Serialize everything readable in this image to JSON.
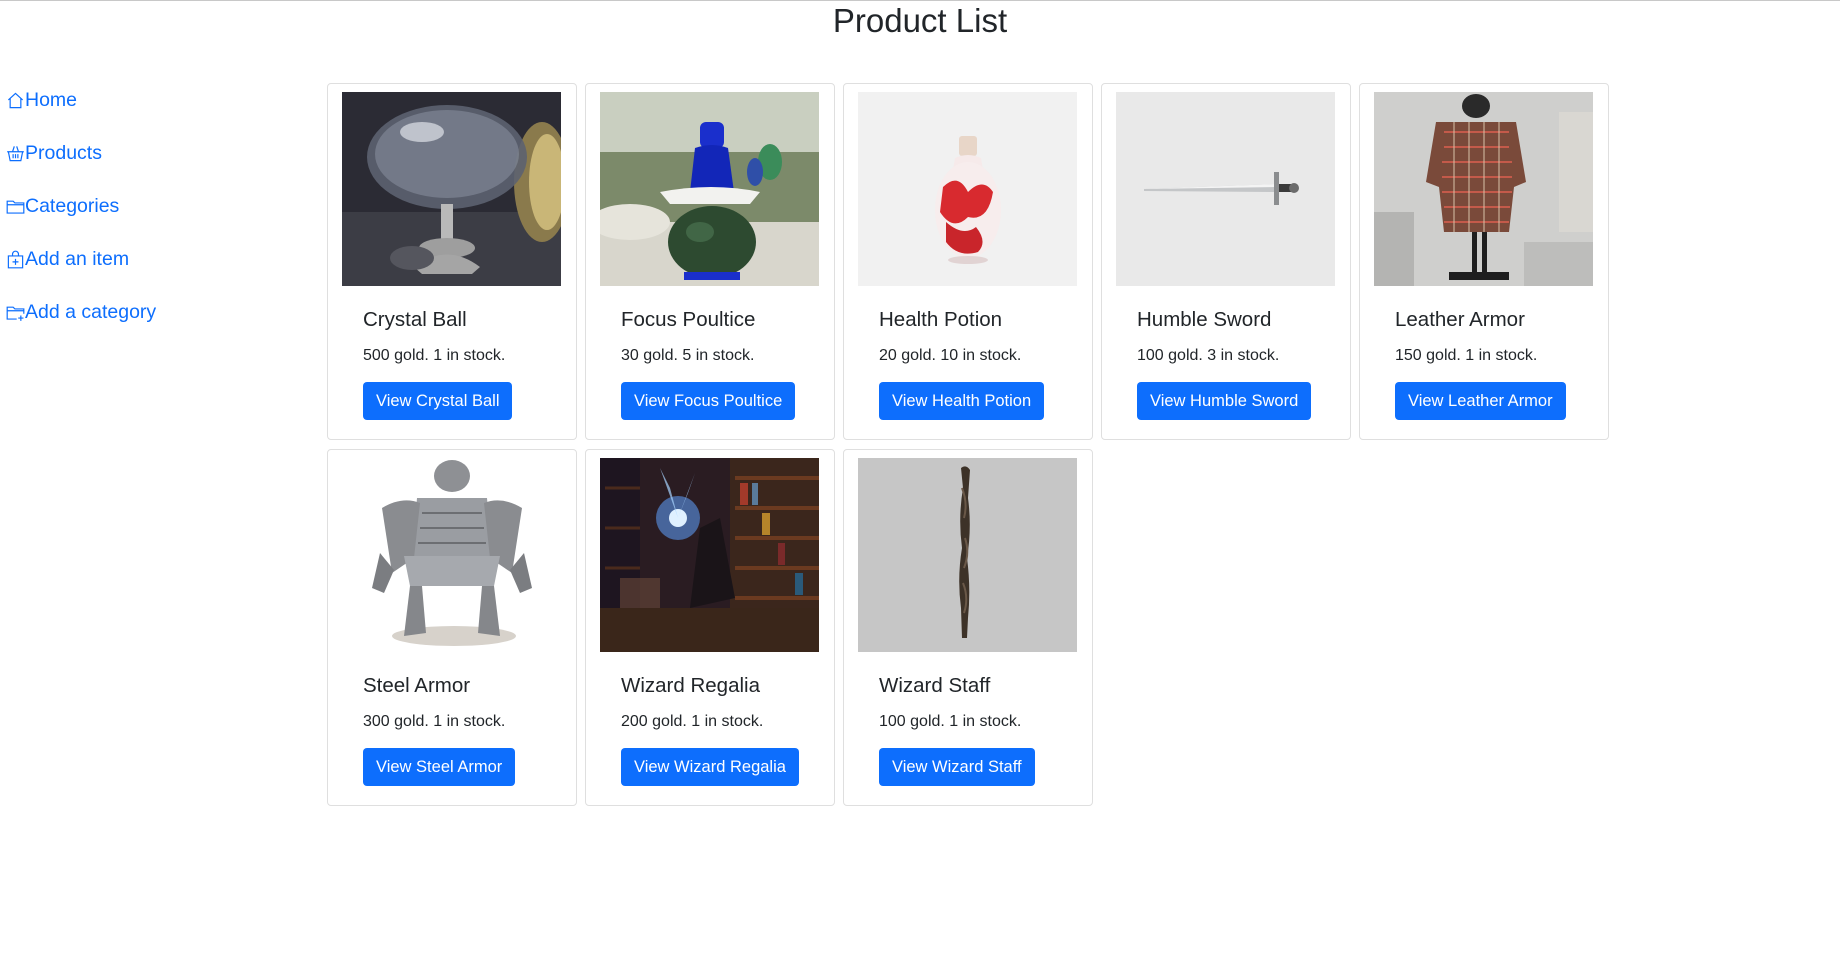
{
  "page": {
    "title": "Product List"
  },
  "sidebar": {
    "items": [
      {
        "label": "Home",
        "icon": "house-icon"
      },
      {
        "label": "Products",
        "icon": "basket-icon"
      },
      {
        "label": "Categories",
        "icon": "folder-icon"
      },
      {
        "label": "Add an item",
        "icon": "bag-plus-icon"
      },
      {
        "label": "Add a category",
        "icon": "folder-plus-icon"
      }
    ]
  },
  "colors": {
    "link": "#0d6efd",
    "button": "#0d6efd",
    "text": "#212529"
  },
  "products": [
    {
      "name": "Crystal Ball",
      "details": "500 gold. 1 in stock.",
      "button": "View Crystal Ball",
      "image": "crystal-ball-image"
    },
    {
      "name": "Focus Poultice",
      "details": "30 gold. 5 in stock.",
      "button": "View Focus Poultice",
      "image": "focus-poultice-image"
    },
    {
      "name": "Health Potion",
      "details": "20 gold. 10 in stock.",
      "button": "View Health Potion",
      "image": "health-potion-image"
    },
    {
      "name": "Humble Sword",
      "details": "100 gold. 3 in stock.",
      "button": "View Humble Sword",
      "image": "humble-sword-image"
    },
    {
      "name": "Leather Armor",
      "details": "150 gold. 1 in stock.",
      "button": "View Leather Armor",
      "image": "leather-armor-image"
    },
    {
      "name": "Steel Armor",
      "details": "300 gold. 1 in stock.",
      "button": "View Steel Armor",
      "image": "steel-armor-image"
    },
    {
      "name": "Wizard Regalia",
      "details": "200 gold. 1 in stock.",
      "button": "View Wizard Regalia",
      "image": "wizard-regalia-image"
    },
    {
      "name": "Wizard Staff",
      "details": "100 gold. 1 in stock.",
      "button": "View Wizard Staff",
      "image": "wizard-staff-image"
    }
  ]
}
